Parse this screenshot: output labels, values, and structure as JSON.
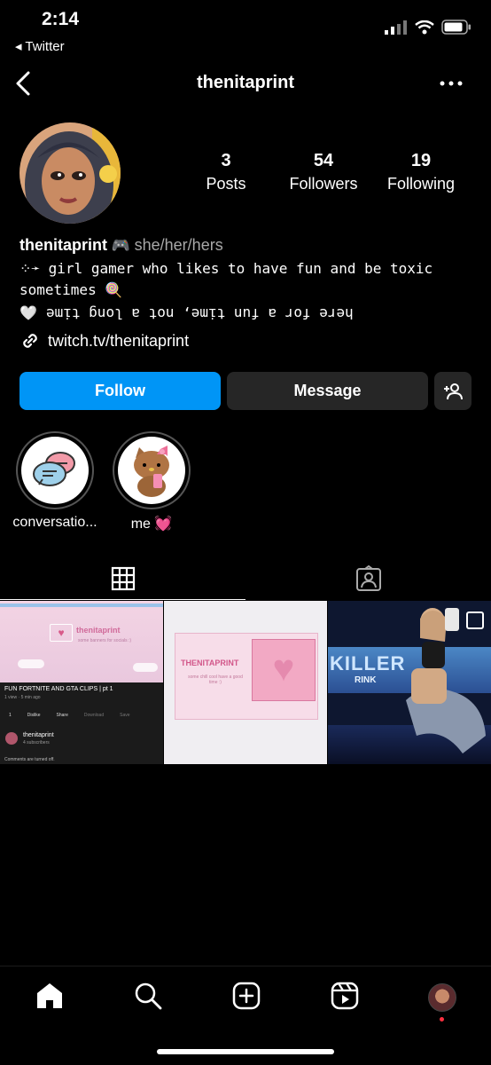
{
  "status": {
    "time": "2:14",
    "back_app": "◂ Twitter"
  },
  "header": {
    "username": "thenitaprint"
  },
  "stats": [
    {
      "value": "3",
      "label": "Posts"
    },
    {
      "value": "54",
      "label": "Followers"
    },
    {
      "value": "19",
      "label": "Following"
    }
  ],
  "bio": {
    "name": "thenitaprint",
    "emoji": "🎮",
    "pronouns": "she/her/hers",
    "line1": "⁘➛ girl gamer who likes to have fun and be toxic sometimes",
    "line1_emoji": "🍭",
    "line2_heart": "🤍",
    "line2": "here for a fun time, not a long time",
    "link": "twitch.tv/thenitaprint"
  },
  "buttons": {
    "follow": "Follow",
    "message": "Message"
  },
  "highlights": [
    {
      "label": "conversatio..."
    },
    {
      "label": "me 💓"
    }
  ],
  "post1": {
    "title": "FUN FORTNITE AND GTA CLIPS | pt 1",
    "meta": "1 view · 5 min ago",
    "actions": [
      "1",
      "Dislike",
      "Share",
      "Download",
      "Save"
    ],
    "channel": "thenitaprint",
    "subs": "4 subscribers",
    "comments": "Comments are turned off.",
    "banner": "thenitaprint",
    "banner_sub": "some banners for socials :)"
  },
  "post2": {
    "title": "THENITAPRINT",
    "sub": "some chill cool have a good time :)"
  },
  "post3": {
    "sign": "KILLER",
    "sign2": "RINK"
  }
}
